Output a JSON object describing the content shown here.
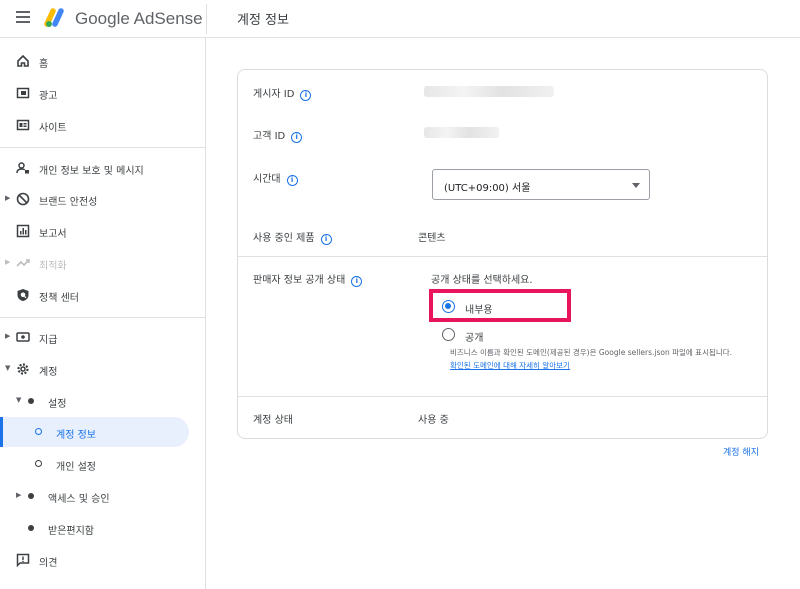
{
  "app": {
    "brand": "Google AdSense",
    "page_title": "계정 정보"
  },
  "sidebar": {
    "items": [
      {
        "label": "홈",
        "icon": "home-icon"
      },
      {
        "label": "광고",
        "icon": "ads-icon"
      },
      {
        "label": "사이트",
        "icon": "sites-icon"
      },
      {
        "label": "개인 정보 보호 및 메시지",
        "icon": "privacy-messaging-icon"
      },
      {
        "label": "브랜드 안전성",
        "icon": "block-icon"
      },
      {
        "label": "보고서",
        "icon": "reports-icon"
      },
      {
        "label": "최적화",
        "icon": "trending-icon"
      },
      {
        "label": "정책 센터",
        "icon": "policy-icon"
      },
      {
        "label": "지급",
        "icon": "payments-icon"
      },
      {
        "label": "계정",
        "icon": "gear-icon"
      },
      {
        "label": "설정"
      },
      {
        "label": "계정 정보"
      },
      {
        "label": "개인 설정"
      },
      {
        "label": "액세스 및 승인"
      },
      {
        "label": "받은편지함"
      },
      {
        "label": "의견",
        "icon": "feedback-icon"
      }
    ]
  },
  "account": {
    "publisher_id_label": "게시자 ID",
    "customer_id_label": "고객 ID",
    "timezone_label": "시간대",
    "timezone_value": "(UTC+09:00) 서울",
    "products_label": "사용 중인 제품",
    "products_value": "콘텐츠",
    "visibility_label": "판매자 정보 공개 상태",
    "visibility_prompt": "공개 상태를 선택하세요.",
    "option_internal": "내부용",
    "option_public": "공개",
    "public_desc": "비즈니스 이름과 확인된 도메인(제공된 경우)은 Google sellers.json 파일에 표시됩니다.",
    "public_link": "확인된 도메인에 대해 자세히 알아보기",
    "status_label": "계정 상태",
    "status_value": "사용 중",
    "selected_option": "내부용"
  },
  "footer": {
    "terminate_link": "계정 해지"
  },
  "colors": {
    "accent": "#1a73e8",
    "highlight": "#e8145d"
  }
}
